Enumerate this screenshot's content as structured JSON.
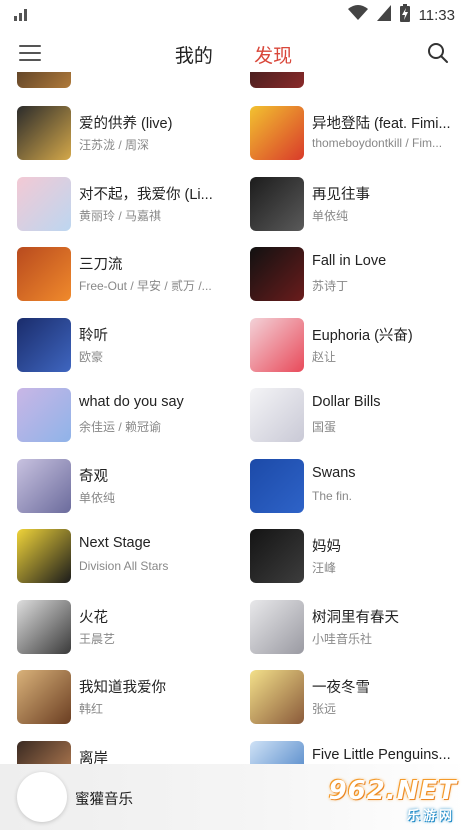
{
  "status_bar": {
    "time": "11:33",
    "signal_icon": "signal-bars-icon",
    "wifi_icon": "wifi-icon",
    "battery_icon": "battery-charging-icon"
  },
  "app_bar": {
    "menu_icon": "hamburger-menu-icon",
    "tab_mine": "我的",
    "tab_discover": "发现",
    "search_icon": "search-icon",
    "active_color": "#d9473a"
  },
  "left_column": [
    {
      "title": "爱的供养 (live)",
      "artist": "汪苏泷 / 周深",
      "cover": [
        "#2b2b2b",
        "#d4a84a"
      ]
    },
    {
      "title": "对不起，我爱你 (Li...",
      "artist": "黄丽玲 / 马嘉祺",
      "cover": [
        "#f3c9d4",
        "#bcd6f0"
      ]
    },
    {
      "title": "三刀流",
      "artist": "Free-Out / 早安 / 贰万 /...",
      "cover": [
        "#b84a1e",
        "#f08a2c"
      ]
    },
    {
      "title": "聆听",
      "artist": "欧豪",
      "cover": [
        "#1a2c6b",
        "#3f66c0"
      ]
    },
    {
      "title": "what do you say",
      "artist": "余佳运 / 赖冠谕",
      "cover": [
        "#c9b6e6",
        "#8fb3e8"
      ]
    },
    {
      "title": "奇观",
      "artist": "单依纯",
      "cover": [
        "#c8c2e0",
        "#6b6b9c"
      ]
    },
    {
      "title": "Next Stage",
      "artist": "Division All Stars",
      "cover": [
        "#f0d43a",
        "#1b1b1b"
      ]
    },
    {
      "title": "火花",
      "artist": "王晨艺",
      "cover": [
        "#dedede",
        "#3a3a3a"
      ]
    },
    {
      "title": "我知道我爱你",
      "artist": "韩红",
      "cover": [
        "#d9b27a",
        "#6b3e22"
      ]
    },
    {
      "title": "离岸",
      "artist": "",
      "cover": [
        "#3a2a22",
        "#c98a5a"
      ]
    }
  ],
  "right_column": [
    {
      "title": "异地登陆 (feat. Fimi...",
      "artist": "thomeboydontkill / Fim...",
      "cover": [
        "#f2c230",
        "#d93a2a"
      ]
    },
    {
      "title": "再见往事",
      "artist": "单依纯",
      "cover": [
        "#1c1c1c",
        "#5a5a5a"
      ]
    },
    {
      "title": "Fall in Love",
      "artist": "苏诗丁",
      "cover": [
        "#111111",
        "#6a1c1c"
      ]
    },
    {
      "title": "Euphoria (兴奋)",
      "artist": "赵让",
      "cover": [
        "#f3d2d8",
        "#e84a5a"
      ]
    },
    {
      "title": "Dollar Bills",
      "artist": "国蛋",
      "cover": [
        "#f4f4f6",
        "#c9c9d6"
      ]
    },
    {
      "title": "Swans",
      "artist": "The fin.",
      "cover": [
        "#1c4aa8",
        "#2e63c8"
      ]
    },
    {
      "title": "妈妈",
      "artist": "汪峰",
      "cover": [
        "#141414",
        "#3d3d3d"
      ]
    },
    {
      "title": "树洞里有春天",
      "artist": "小哇音乐社",
      "cover": [
        "#e8e8ea",
        "#9a9aa2"
      ]
    },
    {
      "title": "一夜冬雪",
      "artist": "张远",
      "cover": [
        "#f3e08a",
        "#8a5a3a"
      ]
    },
    {
      "title": "Five Little Penguins...",
      "artist": "",
      "cover": [
        "#cfe2f6",
        "#3a76c0"
      ]
    }
  ],
  "player": {
    "title": "蜜獾音乐"
  },
  "watermark": {
    "number": "962.NET",
    "sub": "乐游网"
  }
}
